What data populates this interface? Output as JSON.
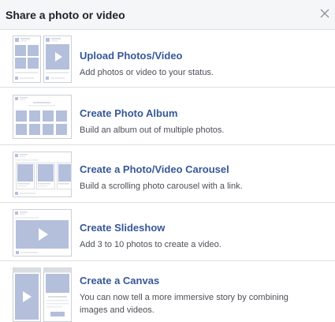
{
  "dialog": {
    "title": "Share a photo or video",
    "close_icon": "close-icon"
  },
  "options": [
    {
      "title": "Upload Photos/Video",
      "description": "Add photos or video to your status.",
      "icon": "upload-photos-thumbnail"
    },
    {
      "title": "Create Photo Album",
      "description": "Build an album out of multiple photos.",
      "icon": "photo-album-thumbnail"
    },
    {
      "title": "Create a Photo/Video Carousel",
      "description": "Build a scrolling photo carousel with a link.",
      "icon": "carousel-thumbnail"
    },
    {
      "title": "Create Slideshow",
      "description": "Add 3 to 10 photos to create a video.",
      "icon": "slideshow-thumbnail"
    },
    {
      "title": "Create a Canvas",
      "description": "You can now tell a more immersive story by combining images and videos.",
      "icon": "canvas-thumbnail"
    }
  ],
  "colors": {
    "link_blue": "#365899",
    "placeholder_blue": "#b4bfdc",
    "border": "#dddfe2",
    "header_bg": "#f5f6f7"
  }
}
